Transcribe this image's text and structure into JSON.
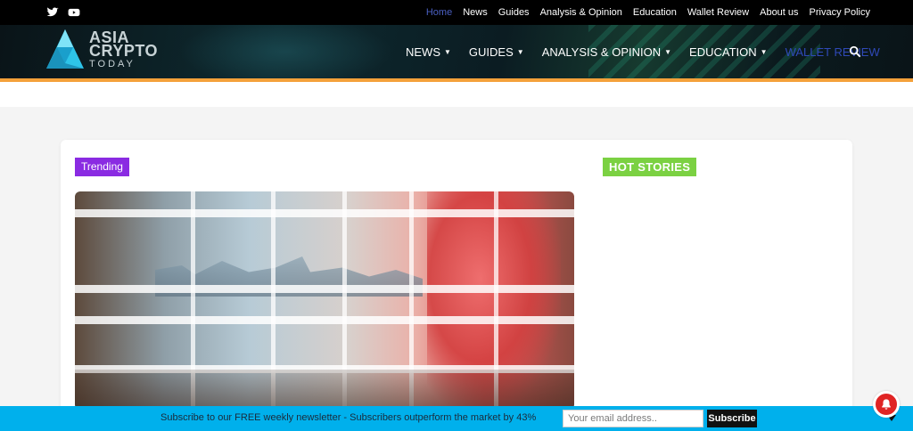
{
  "topbar": {
    "social": [
      {
        "icon": "twitter-icon"
      },
      {
        "icon": "youtube-icon"
      }
    ],
    "nav": [
      {
        "label": "Home",
        "current": true
      },
      {
        "label": "News"
      },
      {
        "label": "Guides"
      },
      {
        "label": "Analysis & Opinion"
      },
      {
        "label": "Education"
      },
      {
        "label": "Wallet Review"
      },
      {
        "label": "About us"
      },
      {
        "label": "Privacy Policy"
      }
    ]
  },
  "logo": {
    "line1": "ASIA",
    "line2": "CRYPTO",
    "line3": "TODAY"
  },
  "mainnav": [
    {
      "label": "NEWS",
      "dropdown": true
    },
    {
      "label": "GUIDES",
      "dropdown": true
    },
    {
      "label": "ANALYSIS & OPINION",
      "dropdown": true
    },
    {
      "label": "EDUCATION",
      "dropdown": true
    },
    {
      "label": "WALLET REVIEW",
      "dropdown": false
    }
  ],
  "search_icon": "search-icon",
  "content": {
    "trending_label": "Trending",
    "hot_stories_label": "HOT STORIES"
  },
  "subscribe": {
    "message": "Subscribe to our FREE weekly newsletter - Subscribers outperform the market by 43%",
    "email_placeholder": "Your email address..",
    "button_label": "Subscribe"
  },
  "colors": {
    "accent_orange": "#f4a13a",
    "trending_purple": "#8a2be2",
    "hot_green": "#7bd142",
    "subscribe_blue": "#00b0ec",
    "notification_red": "#e02424"
  }
}
